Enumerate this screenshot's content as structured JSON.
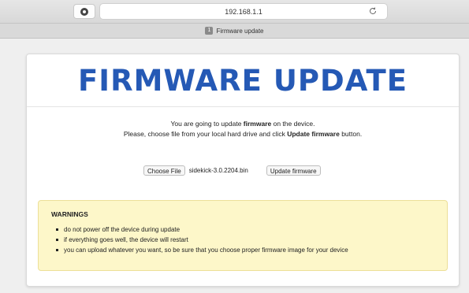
{
  "browser": {
    "url": "192.168.1.1",
    "tab_number": "1",
    "tab_title": "Firmware update"
  },
  "page": {
    "title": "FIRMWARE UPDATE",
    "intro_line1_prefix": "You are going to update ",
    "intro_line1_bold": "firmware",
    "intro_line1_suffix": " on the device.",
    "intro_line2_prefix": "Please, choose file from your local hard drive and click ",
    "intro_line2_bold": "Update firmware",
    "intro_line2_suffix": " button."
  },
  "form": {
    "choose_file_label": "Choose File",
    "selected_file": "sidekick-3.0.2204.bin",
    "update_button_label": "Update firmware"
  },
  "warnings": {
    "title": "WARNINGS",
    "items": [
      "do not power off the device during update",
      "if everything goes well, the device will restart",
      "you can upload whatever you want, so be sure that you choose proper firmware image for your device"
    ]
  },
  "colors": {
    "title": "#2559b5",
    "warning_background": "#fdf7c9"
  }
}
